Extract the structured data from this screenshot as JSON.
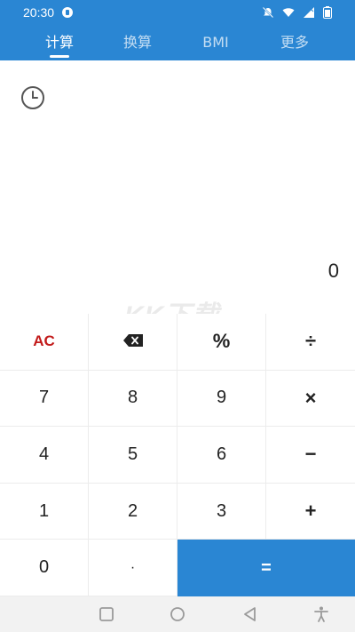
{
  "status_bar": {
    "time": "20:30",
    "icons": [
      "app-notification-icon",
      "mute-icon",
      "wifi-icon",
      "signal-icon",
      "battery-icon"
    ]
  },
  "tabs": [
    {
      "label": "计算",
      "active": true
    },
    {
      "label": "换算",
      "active": false
    },
    {
      "label": "BMI",
      "active": false
    },
    {
      "label": "更多",
      "active": false
    }
  ],
  "display": {
    "history_icon": "clock-icon",
    "value": "0"
  },
  "watermark": {
    "text": "KK下载",
    "url": "www.kkx.net"
  },
  "keypad": {
    "row1": [
      "AC",
      "⌫",
      "%",
      "÷"
    ],
    "row2": [
      "7",
      "8",
      "9",
      "×"
    ],
    "row3": [
      "4",
      "5",
      "6",
      "−"
    ],
    "row4": [
      "1",
      "2",
      "3",
      "+"
    ],
    "row5": [
      "0",
      "·",
      "="
    ]
  },
  "navbar": {
    "buttons": [
      "square-icon",
      "circle-icon",
      "triangle-back-icon",
      "accessibility-icon"
    ]
  },
  "colors": {
    "accent": "#2a86d3",
    "clear_red": "#c21b1b",
    "navbar_bg": "#f2f2f2"
  }
}
